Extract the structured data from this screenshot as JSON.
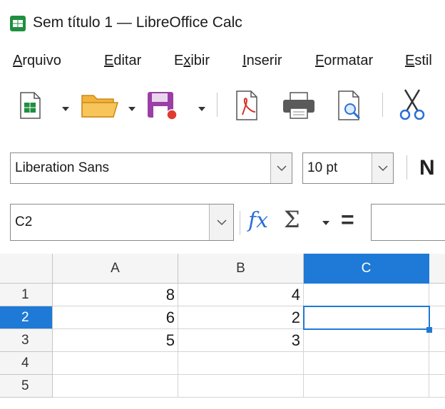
{
  "window": {
    "title": "Sem título 1 — LibreOffice Calc"
  },
  "menu": {
    "items": [
      {
        "label_first": "A",
        "label_rest": "rquivo"
      },
      {
        "label_first": "E",
        "label_rest": "ditar"
      },
      {
        "label_pre": "E",
        "label_first": "x",
        "label_rest": "ibir"
      },
      {
        "label_first": "I",
        "label_rest": "nserir"
      },
      {
        "label_first": "F",
        "label_rest": "ormatar"
      },
      {
        "label_first": "E",
        "label_rest": "stil"
      }
    ]
  },
  "format": {
    "font_name": "Liberation Sans",
    "font_size": "10 pt",
    "bold_label": "N"
  },
  "formula": {
    "name_box": "C2",
    "fx_label": "fx",
    "sigma_label": "Σ",
    "equals_label": "=",
    "input_value": ""
  },
  "sheet": {
    "columns": [
      "A",
      "B",
      "C"
    ],
    "rows": [
      "1",
      "2",
      "3",
      "4",
      "5"
    ],
    "active_column": "C",
    "active_row": "2",
    "cells": [
      [
        "8",
        "4",
        ""
      ],
      [
        "6",
        "2",
        ""
      ],
      [
        "5",
        "3",
        ""
      ],
      [
        "",
        "",
        ""
      ],
      [
        "",
        "",
        ""
      ]
    ]
  },
  "colors": {
    "accent": "#1e7ad6",
    "calc_green": "#1f8f3f"
  },
  "icons": [
    "calc-app-icon",
    "new-spreadsheet-icon",
    "open-folder-icon",
    "save-icon",
    "export-pdf-icon",
    "print-icon",
    "print-preview-icon",
    "cut-icon"
  ]
}
